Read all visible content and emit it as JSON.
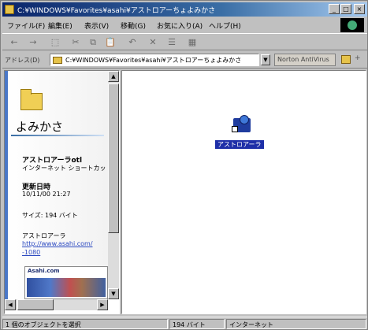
{
  "window": {
    "title": "C:¥WINDOWS¥Favorites¥asahi¥アストロアーちょよみかさ",
    "buttons": {
      "minimize": "_",
      "maximize": "□",
      "close": "×"
    }
  },
  "menu": [
    "ファイル(F)",
    "編集(E)",
    "表示(V)",
    "移動(G)",
    "お気に入り(A)",
    "ヘルプ(H)"
  ],
  "toolbar": {
    "icons": [
      "back-icon",
      "forward-icon",
      "up-icon",
      "cut-icon",
      "copy-icon",
      "paste-icon",
      "undo-icon",
      "delete-icon",
      "properties-icon",
      "views-icon"
    ],
    "glyphs": [
      "←",
      "→",
      "⬚",
      "✂",
      "⧉",
      "📋",
      "↶",
      "✕",
      "☰",
      "▦"
    ]
  },
  "address": {
    "label": "アドレス(D)",
    "value": "C:¥WINDOWS¥Favorites¥asahi¥アストロアーちょよみかさ",
    "norton": "Norton AntiVirus",
    "plus": "+"
  },
  "panel": {
    "title": "よみかさ",
    "file_name": "アストロアーラotl",
    "file_type": "インターネット ショートカット",
    "modified_label": "更新日時",
    "modified_value": "10/11/00 21:27",
    "size": "サイズ: 194 バイト",
    "link_name": "アストロアーラ",
    "link_url": "http://www.asahi.com/",
    "link_tail": "-1080",
    "thumb_title": "Asahi.com"
  },
  "main": {
    "items": [
      {
        "label": "アストロアーラ",
        "icon": "internet-shortcut-icon"
      }
    ]
  },
  "status": {
    "left": "1 個のオブジェクトを選択",
    "size": "194 バイト",
    "zone": "インターネット"
  },
  "colors": {
    "title_start": "#0a246a",
    "title_end": "#a6caf0",
    "selection": "#1e2fa8"
  }
}
